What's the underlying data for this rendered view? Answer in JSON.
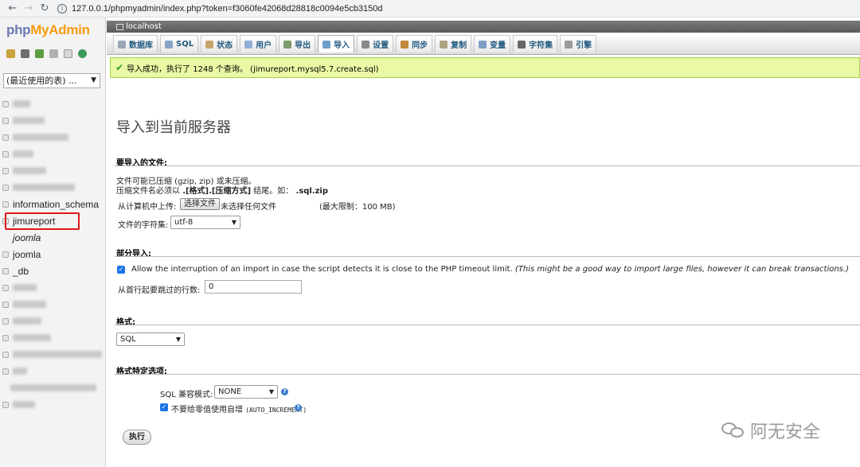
{
  "browser": {
    "url": "127.0.0.1/phpmyadmin/index.php?token=f3060fe42068d28818c0094e5cb3150d"
  },
  "sidebar": {
    "logo_php": "php",
    "logo_my": "My",
    "logo_admin": "Admin",
    "recent_select": "(最近使用的表) ...",
    "databases": [
      {
        "label": "information_schema"
      },
      {
        "label": "jimureport"
      },
      {
        "label": "joomla"
      },
      {
        "label": "joomla"
      },
      {
        "label": "_db"
      }
    ]
  },
  "server": {
    "name": "localhost"
  },
  "tabs": [
    {
      "label": "数据库"
    },
    {
      "label": "SQL"
    },
    {
      "label": "状态"
    },
    {
      "label": "用户"
    },
    {
      "label": "导出"
    },
    {
      "label": "导入"
    },
    {
      "label": "设置"
    },
    {
      "label": "同步"
    },
    {
      "label": "复制"
    },
    {
      "label": "变量"
    },
    {
      "label": "字符集"
    },
    {
      "label": "引擎"
    }
  ],
  "success_message": "导入成功，执行了 1248 个查询。 (jimureport.mysql5.7.create.sql)",
  "page_title": "导入到当前服务器",
  "file_section": {
    "title": "要导入的文件:",
    "compress_note": "文件可能已压缩 (gzip, zip) 或未压缩。",
    "name_note_prefix": "压缩文件名必须以",
    "name_note_format": ".[格式].[压缩方式]",
    "name_note_middle": "结尾。如：",
    "name_note_example": ".sql.zip",
    "upload_label": "从计算机中上传:",
    "choose_file": "选择文件",
    "no_file": "未选择任何文件",
    "max_limit": "(最大限制：100 MB)",
    "charset_label": "文件的字符集:",
    "charset_value": "utf-8"
  },
  "partial_section": {
    "title": "部分导入:",
    "allow_interrupt": "Allow the interruption of an import in case the script detects it is close to the PHP timeout limit.",
    "allow_interrupt_note": "(This might be a good way to import large files, however it can break transactions.)",
    "skip_label": "从首行起要跳过的行数:",
    "skip_value": "0"
  },
  "format_section": {
    "title": "格式:",
    "value": "SQL"
  },
  "format_options": {
    "title": "格式特定选项:",
    "compat_label": "SQL 兼容模式:",
    "compat_value": "NONE",
    "auto_inc_label": "不要给零值使用自增",
    "auto_inc_code": "(AUTO_INCREMENT)"
  },
  "go_button": "执行",
  "watermark": "阿无安全",
  "colors": {
    "success_bg": "#ebf8a4",
    "highlight": "#e0181a",
    "logo_blue": "#6c78af",
    "logo_orange": "#f89c0e"
  }
}
